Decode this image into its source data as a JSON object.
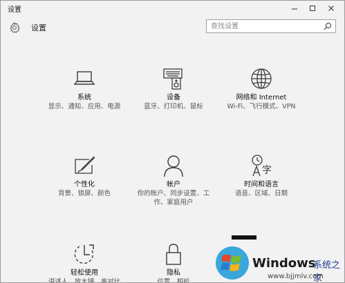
{
  "window": {
    "title": "设置",
    "controls": {
      "minimize": "—",
      "maximize": "☐",
      "close": "✕"
    }
  },
  "header": {
    "title": "设置",
    "search_placeholder": "查找设置"
  },
  "tiles": [
    {
      "label": "系统",
      "desc": "显示、通知、应用、电源",
      "icon": "laptop-icon"
    },
    {
      "label": "设备",
      "desc": "蓝牙、打印机、鼠标",
      "icon": "devices-icon"
    },
    {
      "label": "网络和 Internet",
      "desc": "Wi-Fi、飞行模式、VPN",
      "icon": "globe-icon"
    },
    {
      "label": "个性化",
      "desc": "背景、锁屏、颜色",
      "icon": "personalization-icon"
    },
    {
      "label": "帐户",
      "desc": "你的帐户、同步设置、工作、家庭用户",
      "icon": "account-icon"
    },
    {
      "label": "时间和语言",
      "desc": "语音、区域、日期",
      "icon": "time-language-icon"
    },
    {
      "label": "轻松使用",
      "desc": "讲述人、放大镜、高对比度",
      "icon": "ease-of-access-icon"
    },
    {
      "label": "隐私",
      "desc": "位置、相机",
      "icon": "lock-icon"
    }
  ],
  "watermark": {
    "brand": "Windows",
    "suffix": "系统之家",
    "url": "www.bjjmlv.com"
  },
  "colors": {
    "background": "#f2f2f2",
    "icon_stroke": "#3a3a3a",
    "watermark_blue": "#1a3c8a"
  }
}
